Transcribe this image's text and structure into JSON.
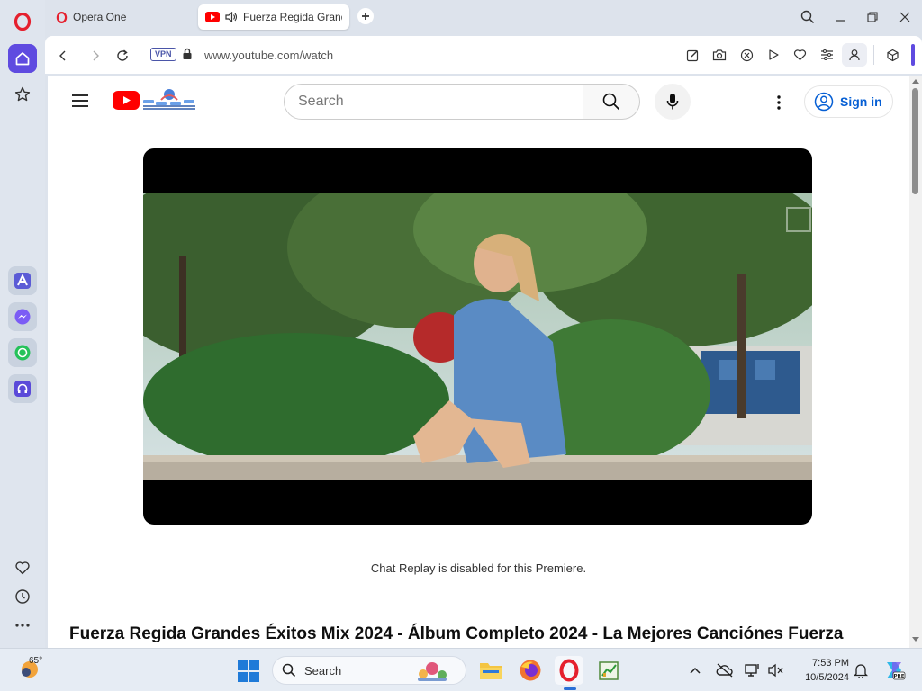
{
  "browser": {
    "tabs": [
      {
        "title": "Opera One",
        "active": false
      },
      {
        "title": "Fuerza Regida Grandes",
        "active": true
      }
    ],
    "address": {
      "vpn_label": "VPN",
      "url": "www.youtube.com/watch"
    },
    "accent_color": "#5f4be0"
  },
  "youtube": {
    "search_placeholder": "Search",
    "sign_in_label": "Sign in",
    "chat_replay_message": "Chat Replay is disabled for this Premiere.",
    "video_title": "Fuerza Regida Grandes Éxitos Mix 2024 - Álbum Completo 2024 - La Mejores Canciónes Fuerza",
    "brand_color": "#ff0000",
    "link_color": "#065fd4"
  },
  "taskbar": {
    "weather_temp": "65°",
    "search_label": "Search",
    "time": "7:53 PM",
    "date": "10/5/2024"
  }
}
